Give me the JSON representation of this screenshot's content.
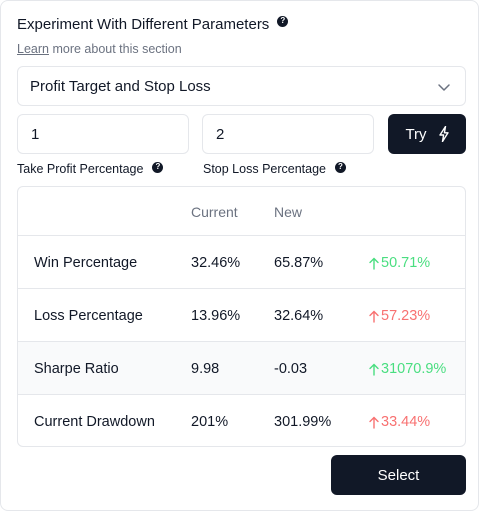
{
  "header": {
    "title": "Experiment With Different Parameters",
    "help_glyph": "?",
    "learn_link": "Learn",
    "subtitle_rest": " more about this section"
  },
  "dropdown": {
    "selected": "Profit Target and Stop Loss"
  },
  "inputs": {
    "take_profit": {
      "value": "1",
      "label": "Take Profit Percentage"
    },
    "stop_loss": {
      "value": "2",
      "label": "Stop Loss Percentage"
    }
  },
  "try_button": {
    "label": "Try",
    "icon": "lightning-icon"
  },
  "table": {
    "columns": [
      "",
      "Current",
      "New",
      ""
    ],
    "rows": [
      {
        "metric": "Win Percentage",
        "current": "32.46%",
        "new": "65.87%",
        "change": "50.71%",
        "direction": "up",
        "tone": "positive"
      },
      {
        "metric": "Loss Percentage",
        "current": "13.96%",
        "new": "32.64%",
        "change": "57.23%",
        "direction": "up",
        "tone": "negative"
      },
      {
        "metric": "Sharpe Ratio",
        "current": "9.98",
        "new": "-0.03",
        "change": "31070.9%",
        "direction": "up",
        "tone": "positive"
      },
      {
        "metric": "Current Drawdown",
        "current": "201%",
        "new": "301.99%",
        "change": "33.44%",
        "direction": "up",
        "tone": "negative"
      }
    ]
  },
  "select_button": {
    "label": "Select"
  },
  "colors": {
    "primary_dark": "#111827",
    "positive": "#4ade80",
    "negative": "#f87171",
    "muted_text": "#6b7280",
    "border": "#e5e7eb"
  }
}
